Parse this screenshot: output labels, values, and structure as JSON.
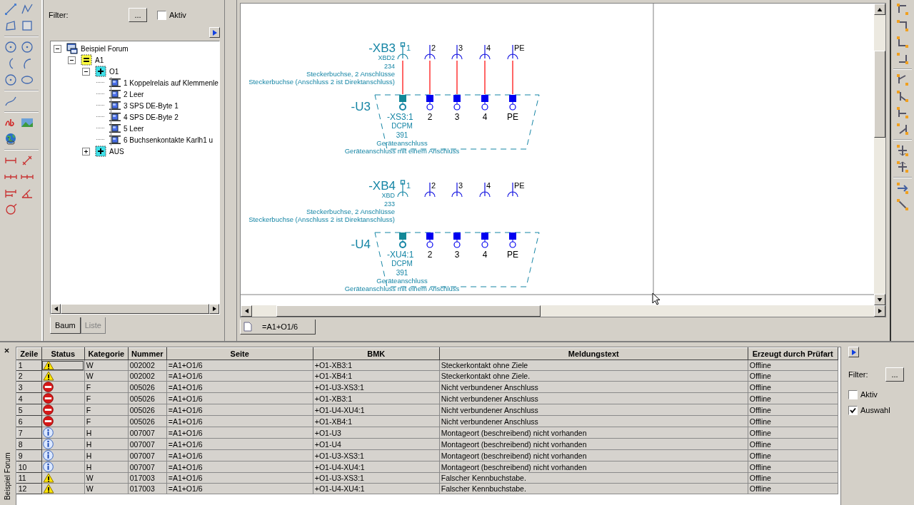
{
  "pages_panel": {
    "filter_label": "Filter:",
    "filter_button": "...",
    "active": {
      "label": "Aktiv",
      "checked": false
    },
    "tree": [
      {
        "label": "Beispiel Forum",
        "kind": "project",
        "expanded": true,
        "children": [
          {
            "label": "A1",
            "kind": "function",
            "expanded": true,
            "children": [
              {
                "label": "O1",
                "kind": "location",
                "expanded": true,
                "children": [
                  {
                    "label": "1 Koppelrelais auf Klemmenle",
                    "kind": "page"
                  },
                  {
                    "label": "2 Leer",
                    "kind": "page"
                  },
                  {
                    "label": "3 SPS DE-Byte 1",
                    "kind": "page"
                  },
                  {
                    "label": "4 SPS DE-Byte 2",
                    "kind": "page"
                  },
                  {
                    "label": "5 Leer",
                    "kind": "page"
                  },
                  {
                    "label": "6 Buchsenkontakte Karlh1 u",
                    "kind": "page"
                  }
                ]
              },
              {
                "label": "AUS",
                "kind": "location",
                "expanded": false
              }
            ]
          }
        ]
      }
    ],
    "tabs": [
      {
        "label": "Baum",
        "selected": true
      },
      {
        "label": "Liste",
        "selected": false
      }
    ]
  },
  "editor": {
    "diagram": {
      "blocks": [
        {
          "plug": "-XB3",
          "plug_info": [
            "XBD2",
            "234",
            "Steckerbuchse, 2 Anschlüsse",
            "Steckerbuchse (Anschluss 2 ist Direktanschluss)"
          ],
          "pins": [
            "1",
            "2",
            "3",
            "4",
            "PE"
          ],
          "wired": true,
          "device": "-U3",
          "socket": "-XS3:1",
          "terminals": [
            "2",
            "3",
            "4",
            "PE"
          ],
          "device_info": [
            "DCPM",
            "391",
            "Geräteanschluss",
            "Geräteanschluss mit einem Anschluss"
          ]
        },
        {
          "plug": "-XB4",
          "plug_info": [
            "XBD",
            "233",
            "Steckerbuchse, 2 Anschlüsse",
            "Steckerbuchse (Anschluss 2 ist Direktanschluss)"
          ],
          "pins": [
            "1",
            "2",
            "3",
            "4",
            "PE"
          ],
          "wired": false,
          "device": "-U4",
          "socket": "-XU4:1",
          "terminals": [
            "2",
            "3",
            "4",
            "PE"
          ],
          "device_info": [
            "DCPM",
            "391",
            "Geräteanschluss",
            "Geräteanschluss mit einem Anschluss"
          ]
        }
      ]
    },
    "tabs": [
      {
        "label": "=A1+O1/6",
        "selected": true
      }
    ]
  },
  "messages": {
    "side_tab": "Beispiel Forum",
    "columns": [
      "Zeile",
      "Status",
      "Kategorie",
      "Nummer",
      "Seite",
      "BMK",
      "Meldungstext",
      "Erzeugt durch Prüfart"
    ],
    "rows": [
      {
        "zeile": "1",
        "kind": "warning",
        "kategorie": "W",
        "nummer": "002002",
        "seite": "=A1+O1/6",
        "bmk": "+O1-XB3:1",
        "text": "Steckerkontakt ohne Ziele",
        "pruefart": "Offline",
        "focused": true
      },
      {
        "zeile": "2",
        "kind": "warning",
        "kategorie": "W",
        "nummer": "002002",
        "seite": "=A1+O1/6",
        "bmk": "+O1-XB4:1",
        "text": "Steckerkontakt ohne Ziele.",
        "pruefart": "Offline",
        "focused": false
      },
      {
        "zeile": "3",
        "kind": "error",
        "kategorie": "F",
        "nummer": "005026",
        "seite": "=A1+O1/6",
        "bmk": "+O1-U3-XS3:1",
        "text": "Nicht verbundener Anschluss",
        "pruefart": "Offline",
        "focused": false
      },
      {
        "zeile": "4",
        "kind": "error",
        "kategorie": "F",
        "nummer": "005026",
        "seite": "=A1+O1/6",
        "bmk": "+O1-XB3:1",
        "text": "Nicht verbundener Anschluss",
        "pruefart": "Offline",
        "focused": false
      },
      {
        "zeile": "5",
        "kind": "error",
        "kategorie": "F",
        "nummer": "005026",
        "seite": "=A1+O1/6",
        "bmk": "+O1-U4-XU4:1",
        "text": "Nicht verbundener Anschluss",
        "pruefart": "Offline",
        "focused": false
      },
      {
        "zeile": "6",
        "kind": "error",
        "kategorie": "F",
        "nummer": "005026",
        "seite": "=A1+O1/6",
        "bmk": "+O1-XB4:1",
        "text": "Nicht verbundener Anschluss",
        "pruefart": "Offline",
        "focused": false
      },
      {
        "zeile": "7",
        "kind": "info",
        "kategorie": "H",
        "nummer": "007007",
        "seite": "=A1+O1/6",
        "bmk": "+O1-U3",
        "text": "Montageort (beschreibend) nicht vorhanden",
        "pruefart": "Offline",
        "focused": false
      },
      {
        "zeile": "8",
        "kind": "info",
        "kategorie": "H",
        "nummer": "007007",
        "seite": "=A1+O1/6",
        "bmk": "+O1-U4",
        "text": "Montageort (beschreibend) nicht vorhanden",
        "pruefart": "Offline",
        "focused": false
      },
      {
        "zeile": "9",
        "kind": "info",
        "kategorie": "H",
        "nummer": "007007",
        "seite": "=A1+O1/6",
        "bmk": "+O1-U3-XS3:1",
        "text": "Montageort (beschreibend) nicht vorhanden",
        "pruefart": "Offline",
        "focused": false
      },
      {
        "zeile": "10",
        "kind": "info",
        "kategorie": "H",
        "nummer": "007007",
        "seite": "=A1+O1/6",
        "bmk": "+O1-U4-XU4:1",
        "text": "Montageort (beschreibend) nicht vorhanden",
        "pruefart": "Offline",
        "focused": false
      },
      {
        "zeile": "11",
        "kind": "warning",
        "kategorie": "W",
        "nummer": "017003",
        "seite": "=A1+O1/6",
        "bmk": "+O1-U3-XS3:1",
        "text": "Falscher Kennbuchstabe.",
        "pruefart": "Offline",
        "focused": false
      },
      {
        "zeile": "12",
        "kind": "warning",
        "kategorie": "W",
        "nummer": "017003",
        "seite": "=A1+O1/6",
        "bmk": "+O1-U4-XU4:1",
        "text": "Falscher Kennbuchstabe.",
        "pruefart": "Offline",
        "focused": false
      }
    ],
    "filter_label": "Filter:",
    "filter_button": "...",
    "options": [
      {
        "label": "Aktiv",
        "checked": false
      },
      {
        "label": "Auswahl",
        "checked": true
      }
    ]
  }
}
